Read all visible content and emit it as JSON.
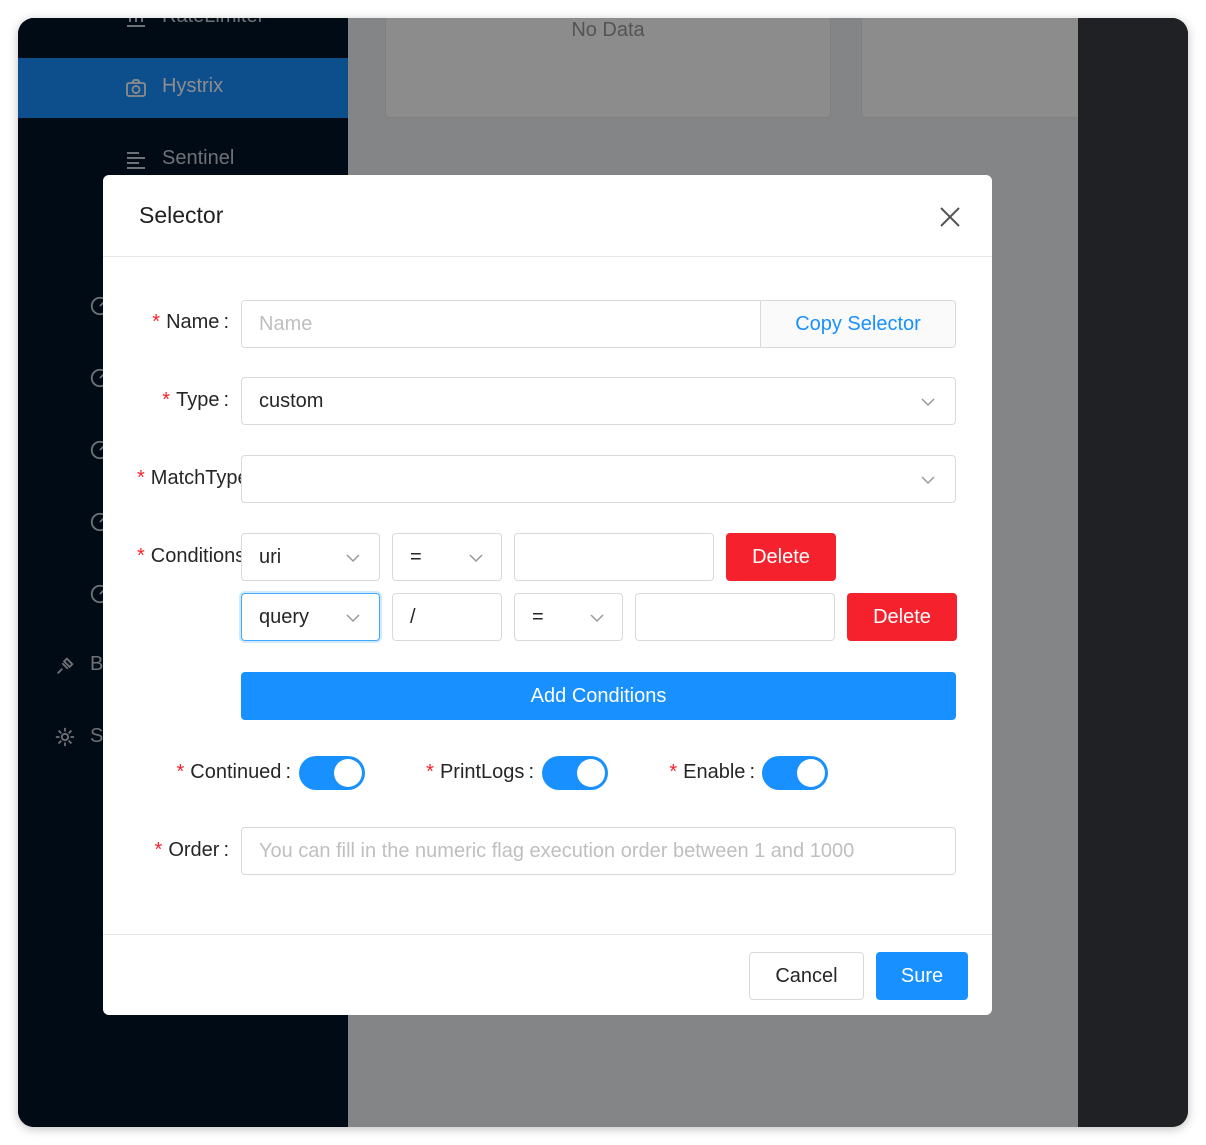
{
  "sidebar": {
    "items": [
      {
        "label": "RateLimiter"
      },
      {
        "label": "Hystrix"
      },
      {
        "label": "Sentinel"
      }
    ],
    "partial_letters": [
      "B",
      "S"
    ]
  },
  "background": {
    "no_data": "No Data"
  },
  "modal": {
    "title": "Selector",
    "name": {
      "label": "Name",
      "placeholder": "Name",
      "addon": "Copy Selector"
    },
    "type": {
      "label": "Type",
      "value": "custom"
    },
    "match_type": {
      "label": "MatchType",
      "value": ""
    },
    "conditions": {
      "label": "Conditions",
      "rows": [
        {
          "param_type": "uri",
          "operator": "=",
          "value": "",
          "delete_label": "Delete"
        },
        {
          "param_type": "query",
          "param_name": "/",
          "operator": "=",
          "value": "",
          "delete_label": "Delete"
        }
      ],
      "add_label": "Add Conditions"
    },
    "continued": {
      "label": "Continued",
      "enabled": true
    },
    "print_logs": {
      "label": "PrintLogs",
      "enabled": true
    },
    "enable": {
      "label": "Enable",
      "enabled": true
    },
    "order": {
      "label": "Order",
      "placeholder": "You can fill in the numeric flag execution order between 1 and 1000"
    },
    "footer": {
      "cancel_label": "Cancel",
      "ok_label": "Sure"
    }
  },
  "colors": {
    "primary": "#1890ff",
    "danger": "#f5222d",
    "sidebar_bg": "#011528",
    "required": "#f5222d"
  }
}
